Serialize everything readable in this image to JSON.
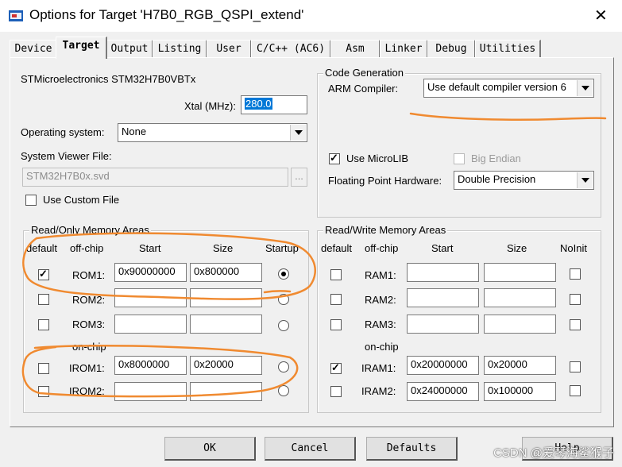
{
  "window": {
    "title": "Options for Target 'H7B0_RGB_QSPI_extend'"
  },
  "tabs": [
    "Device",
    "Target",
    "Output",
    "Listing",
    "User",
    "C/C++ (AC6)",
    "Asm",
    "Linker",
    "Debug",
    "Utilities"
  ],
  "active_tab": "Target",
  "device": {
    "name": "STMicroelectronics STM32H7B0VBTx",
    "xtal_label": "Xtal (MHz):",
    "xtal_value": "280.0",
    "os_label": "Operating system:",
    "os_value": "None",
    "svf_label": "System Viewer File:",
    "svf_value": "STM32H7B0x.svd",
    "browse_label": "...",
    "custom_file_label": "Use Custom File"
  },
  "code_gen": {
    "title": "Code Generation",
    "compiler_label": "ARM Compiler:",
    "compiler_value": "Use default compiler version 6",
    "microlib_label": "Use MicroLIB",
    "microlib_checked": true,
    "big_endian_label": "Big Endian",
    "fpu_label": "Floating Point Hardware:",
    "fpu_value": "Double Precision"
  },
  "rom": {
    "title": "Read/Only Memory Areas",
    "headers": {
      "default": "default",
      "offchip": "off-chip",
      "start": "Start",
      "size": "Size",
      "startup": "Startup"
    },
    "onchip_label": "on-chip",
    "rows": [
      {
        "label": "ROM1:",
        "start": "0x90000000",
        "size": "0x800000",
        "default": true,
        "startup": true
      },
      {
        "label": "ROM2:",
        "start": "",
        "size": "",
        "default": false,
        "startup": false
      },
      {
        "label": "ROM3:",
        "start": "",
        "size": "",
        "default": false,
        "startup": false
      },
      {
        "label": "IROM1:",
        "start": "0x8000000",
        "size": "0x20000",
        "default": false,
        "startup": false
      },
      {
        "label": "IROM2:",
        "start": "",
        "size": "",
        "default": false,
        "startup": false
      }
    ]
  },
  "ram": {
    "title": "Read/Write Memory Areas",
    "headers": {
      "default": "default",
      "offchip": "off-chip",
      "start": "Start",
      "size": "Size",
      "noinit": "NoInit"
    },
    "onchip_label": "on-chip",
    "rows": [
      {
        "label": "RAM1:",
        "start": "",
        "size": "",
        "default": false,
        "noinit": false
      },
      {
        "label": "RAM2:",
        "start": "",
        "size": "",
        "default": false,
        "noinit": false
      },
      {
        "label": "RAM3:",
        "start": "",
        "size": "",
        "default": false,
        "noinit": false
      },
      {
        "label": "IRAM1:",
        "start": "0x20000000",
        "size": "0x20000",
        "default": true,
        "noinit": false
      },
      {
        "label": "IRAM2:",
        "start": "0x24000000",
        "size": "0x100000",
        "default": false,
        "noinit": false
      }
    ]
  },
  "buttons": {
    "ok": "OK",
    "cancel": "Cancel",
    "defaults": "Defaults",
    "help": "Help"
  },
  "watermark": "CSDN @爱琴海鲨猴子",
  "colors": {
    "annotation": "#f08a30",
    "selection": "#0078d7"
  }
}
